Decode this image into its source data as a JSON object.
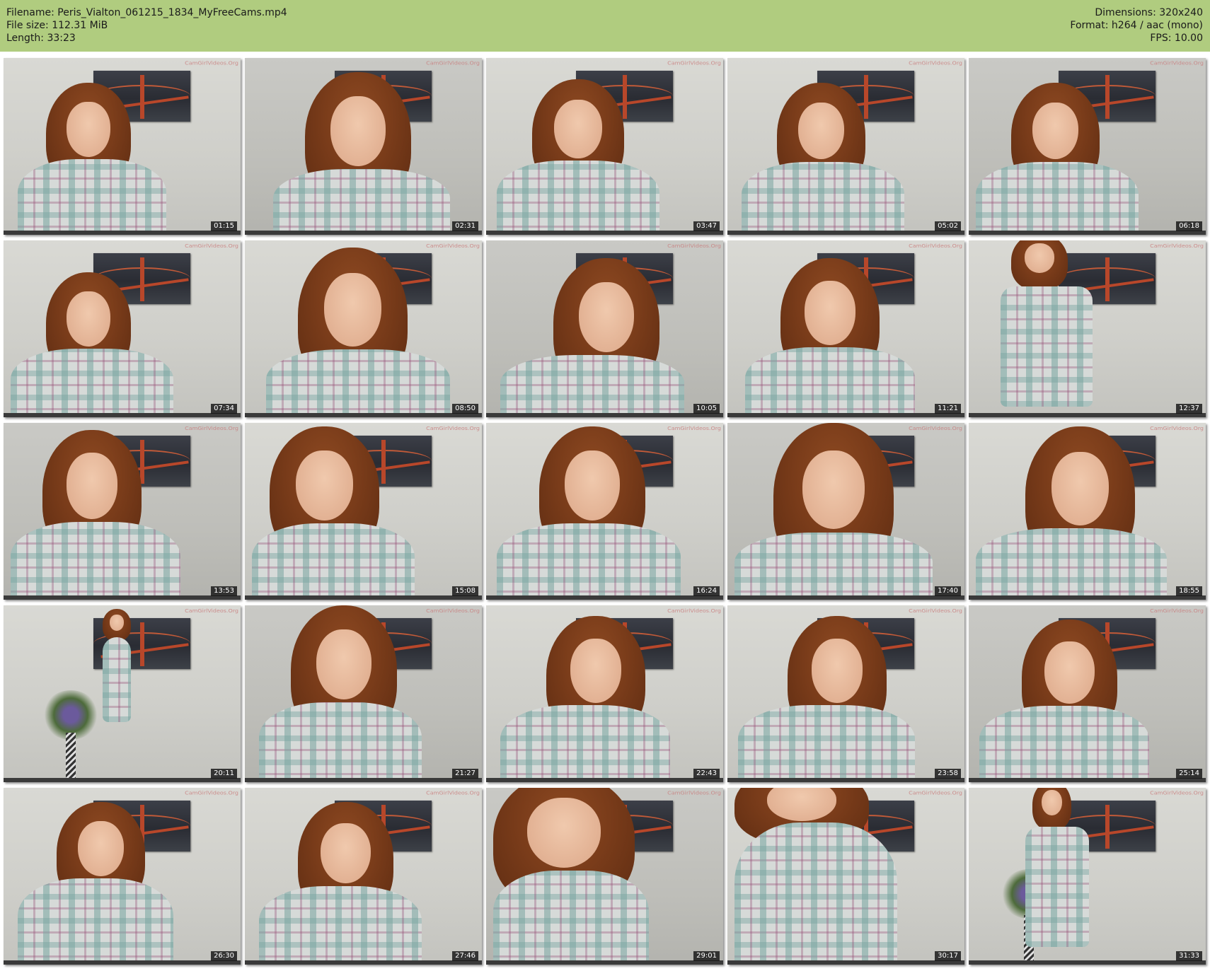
{
  "header": {
    "filename_line": "Filename: Peris_Vialton_061215_1834_MyFreeCams.mp4",
    "filesize_line": "File size: 112.31 MiB",
    "length_line": "Length: 33:23",
    "dimensions_line": "Dimensions: 320x240",
    "format_line": "Format: h264 / aac (mono)",
    "fps_line": "FPS: 10.00",
    "background_color": "#b0cc7f"
  },
  "thumbnails": [
    {
      "timestamp": "01:15"
    },
    {
      "timestamp": "02:31"
    },
    {
      "timestamp": "03:47"
    },
    {
      "timestamp": "05:02"
    },
    {
      "timestamp": "06:18"
    },
    {
      "timestamp": "07:34"
    },
    {
      "timestamp": "08:50"
    },
    {
      "timestamp": "10:05"
    },
    {
      "timestamp": "11:21"
    },
    {
      "timestamp": "12:37"
    },
    {
      "timestamp": "13:53"
    },
    {
      "timestamp": "15:08"
    },
    {
      "timestamp": "16:24"
    },
    {
      "timestamp": "17:40"
    },
    {
      "timestamp": "18:55"
    },
    {
      "timestamp": "20:11"
    },
    {
      "timestamp": "21:27"
    },
    {
      "timestamp": "22:43"
    },
    {
      "timestamp": "23:58"
    },
    {
      "timestamp": "25:14"
    },
    {
      "timestamp": "26:30"
    },
    {
      "timestamp": "27:46"
    },
    {
      "timestamp": "29:01"
    },
    {
      "timestamp": "30:17"
    },
    {
      "timestamp": "31:33"
    }
  ],
  "watermark_text": "CamGirlVideos.Org"
}
